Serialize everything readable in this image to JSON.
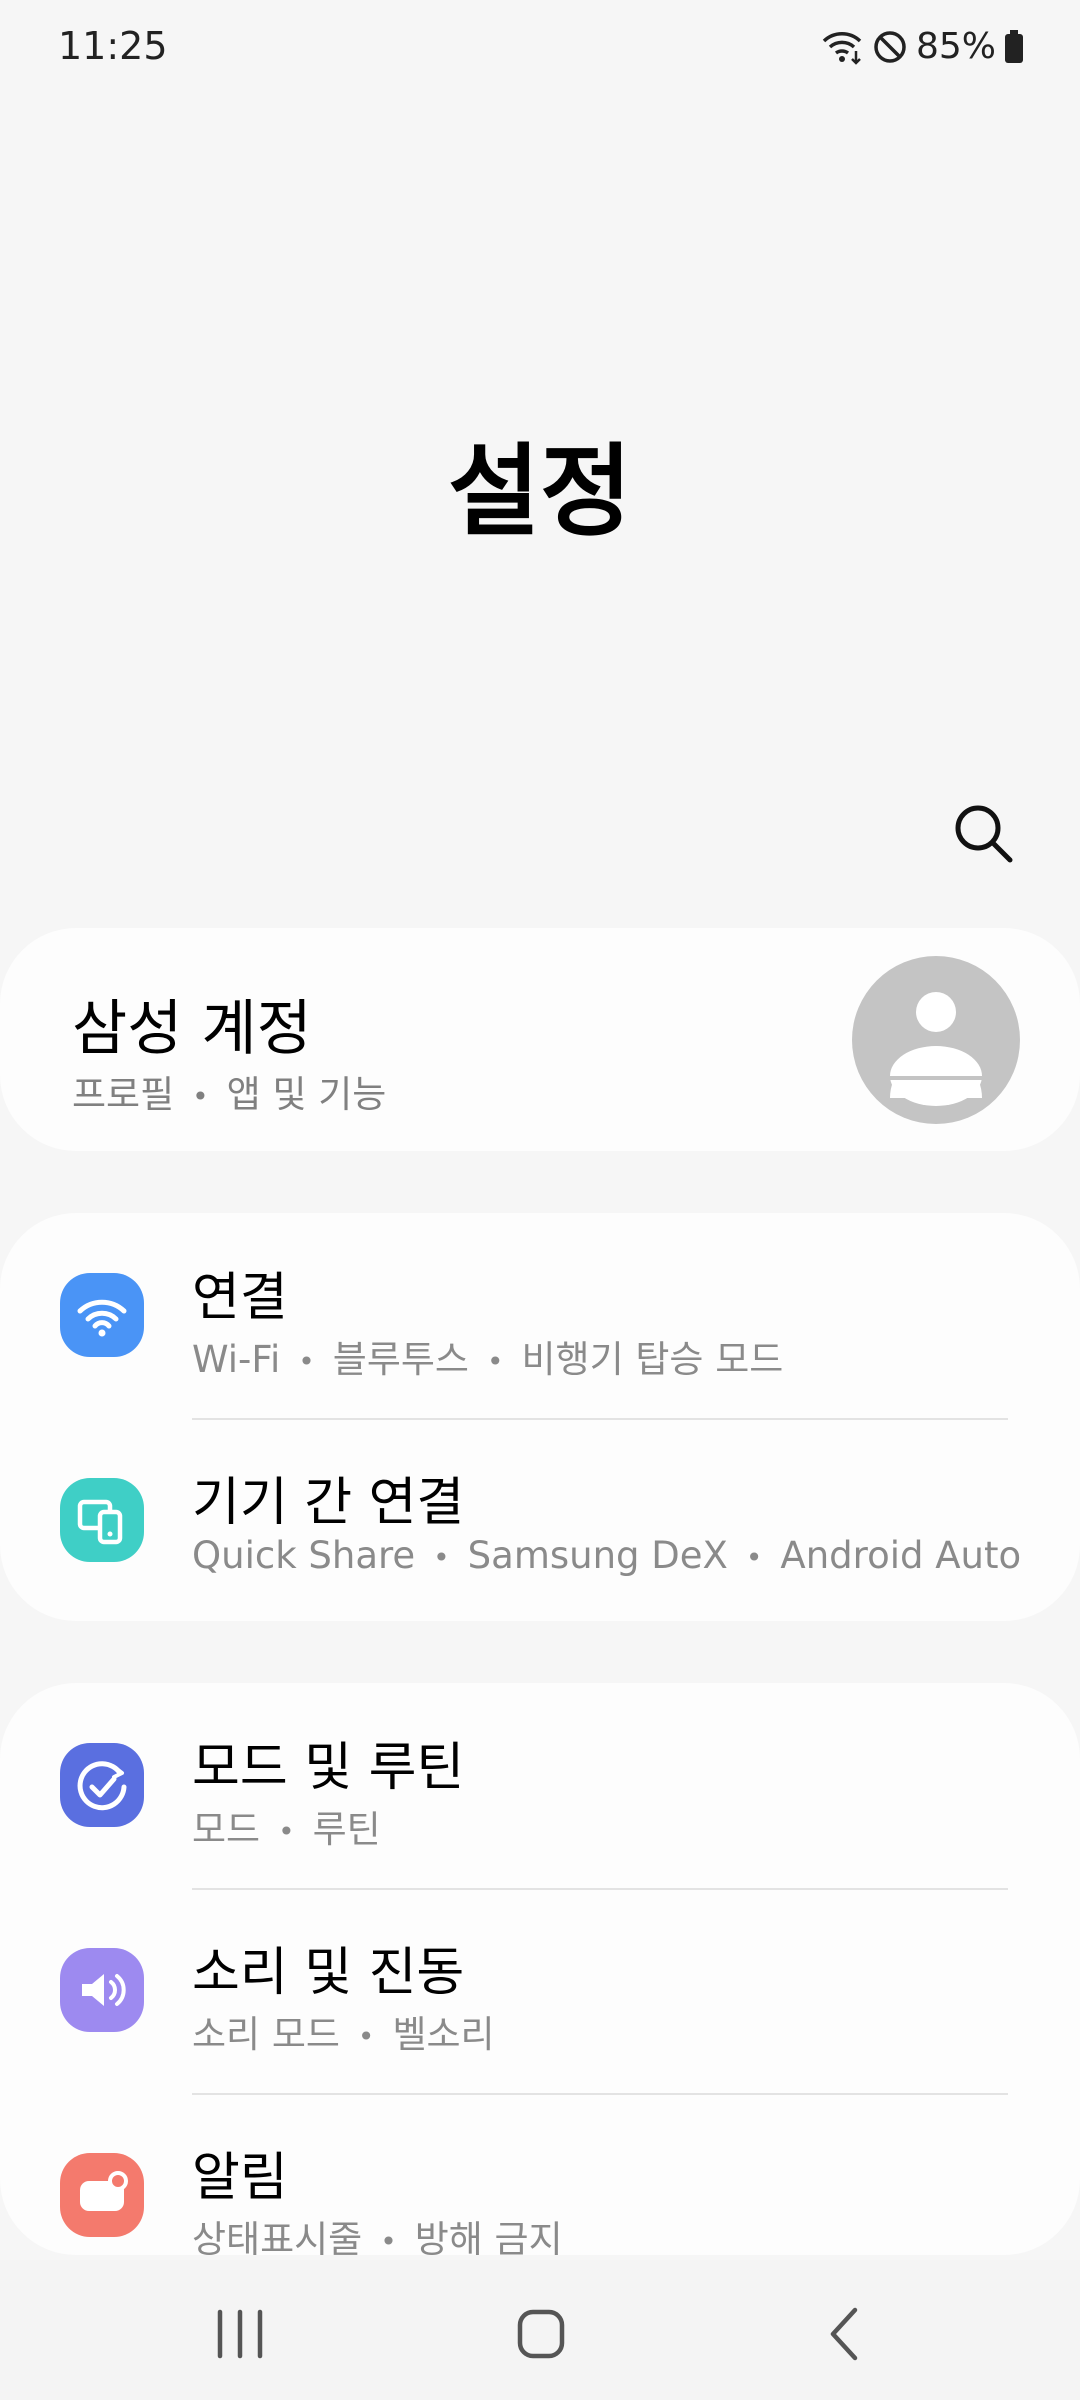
{
  "status_bar": {
    "time": "11:25",
    "battery": "85%",
    "icons": [
      "wifi-icon",
      "do-not-disturb-icon",
      "battery-icon"
    ]
  },
  "header": {
    "title": "설정"
  },
  "search": {
    "icon": "search-icon"
  },
  "account": {
    "title": "삼성 계정",
    "subtitle_parts": [
      "프로필",
      "앱 및 기능"
    ],
    "avatar_icon": "person-avatar-icon"
  },
  "groups": [
    {
      "items": [
        {
          "title": "연결",
          "subtitle_parts": [
            "Wi-Fi",
            "블루투스",
            "비행기 탑승 모드"
          ],
          "icon": "wifi-icon",
          "icon_color": "#4a94f6"
        },
        {
          "title": "기기 간 연결",
          "subtitle_parts": [
            "Quick Share",
            "Samsung DeX",
            "Android Auto"
          ],
          "icon": "connected-devices-icon",
          "icon_color": "#3fcfc6"
        }
      ]
    },
    {
      "items": [
        {
          "title": "모드 및 루틴",
          "subtitle_parts": [
            "모드",
            "루틴"
          ],
          "icon": "modes-routines-icon",
          "icon_color": "#5a6fe0"
        },
        {
          "title": "소리 및 진동",
          "subtitle_parts": [
            "소리 모드",
            "벨소리"
          ],
          "icon": "sound-icon",
          "icon_color": "#9d8af0"
        },
        {
          "title": "알림",
          "subtitle_parts": [
            "상태표시줄",
            "방해 금지"
          ],
          "icon": "notifications-icon",
          "icon_color": "#f47a6d"
        }
      ]
    }
  ],
  "nav_bar": {
    "buttons": [
      "recent-apps-icon",
      "home-icon",
      "back-icon"
    ]
  },
  "colors": {
    "background": "#f6f6f6",
    "card": "#fdfdfd",
    "subtitle": "#8a8a8a"
  }
}
